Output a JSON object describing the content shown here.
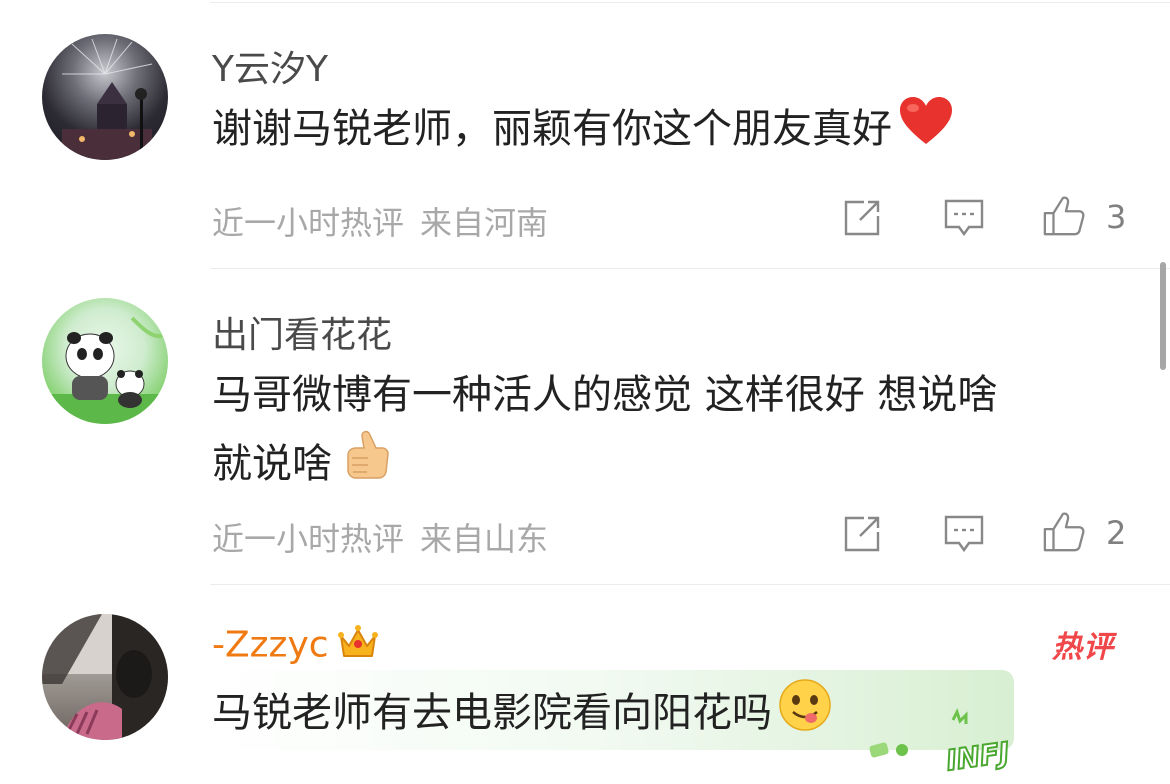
{
  "comments": [
    {
      "username": "Y云汐Y",
      "text": "谢谢马锐老师，丽颖有你这个朋友真好",
      "emoji": "red-heart",
      "time": "近一小时热评",
      "location": "来自河南",
      "likes": "3"
    },
    {
      "username": "出门看花花",
      "text_line1": "马哥微博有一种活人的感觉 这样很好 想说啥",
      "text_line2": "就说啥",
      "emoji": "thumbs-up",
      "time": "近一小时热评",
      "location": "来自山东",
      "likes": "2"
    },
    {
      "username": "-Zzzyc",
      "badge": "crown",
      "hot_label": "热评",
      "text": "马锐老师有去电影院看向阳花吗",
      "emoji": "yum-face",
      "decoration_text": "INFJ"
    }
  ],
  "colors": {
    "vip_name": "#f07a12",
    "hot": "#f0474a",
    "meta": "#a8a8a8"
  }
}
